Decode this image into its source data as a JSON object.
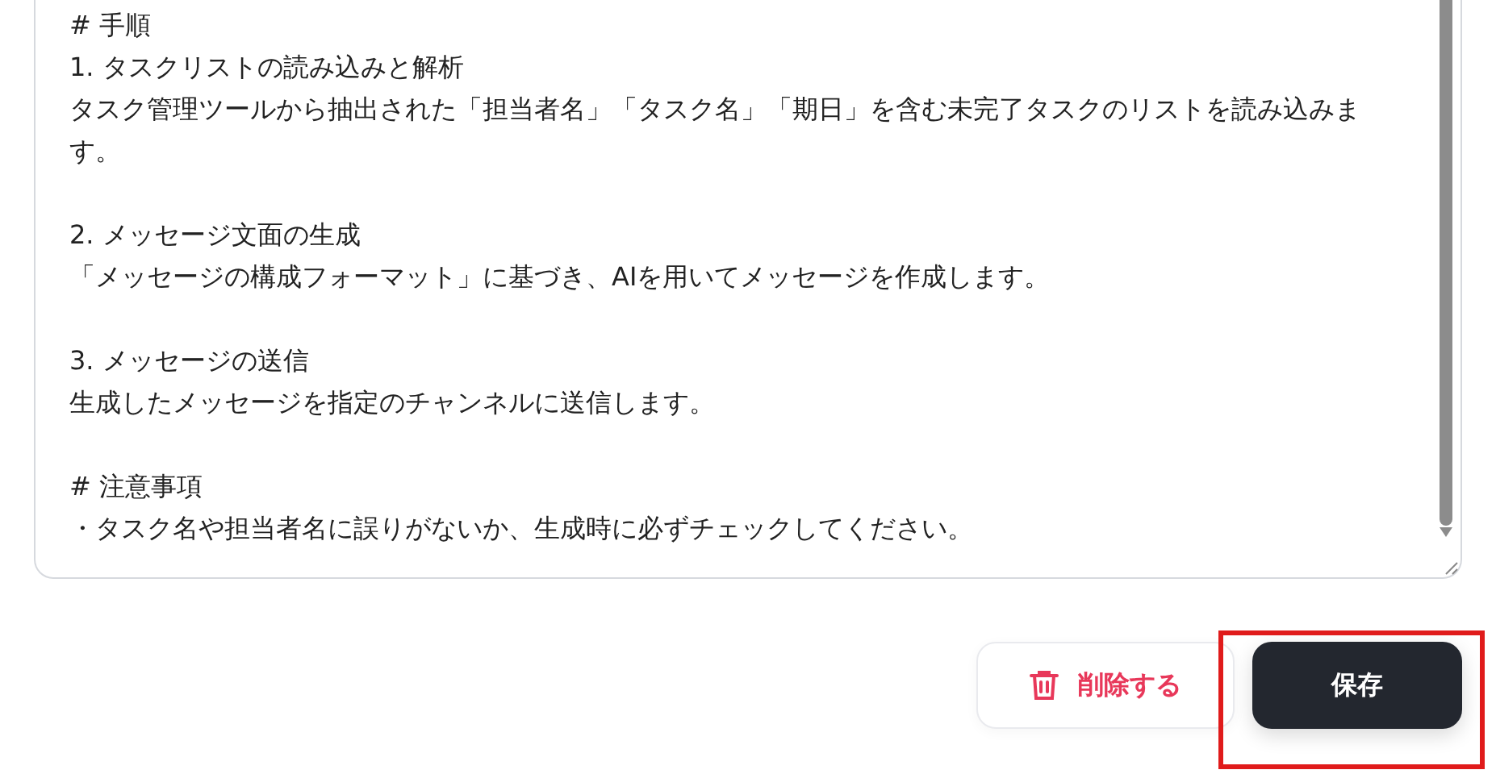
{
  "editor": {
    "blocks": [
      [
        "# 手順",
        "1. タスクリストの読み込みと解析",
        "タスク管理ツールから抽出された「担当者名」「タスク名」「期日」を含む未完了タスクのリストを読み込みます。"
      ],
      [
        "2. メッセージ文面の生成",
        "「メッセージの構成フォーマット」に基づき、AIを用いてメッセージを作成します。"
      ],
      [
        "3. メッセージの送信",
        "生成したメッセージを指定のチャンネルに送信します。"
      ],
      [
        "# 注意事項",
        "・タスク名や担当者名に誤りがないか、生成時に必ずチェックしてください。"
      ]
    ]
  },
  "actions": [
    {
      "kind": "delete",
      "label": "削除する",
      "highlighted": false
    },
    {
      "kind": "save",
      "label": "保存",
      "highlighted": true
    }
  ]
}
